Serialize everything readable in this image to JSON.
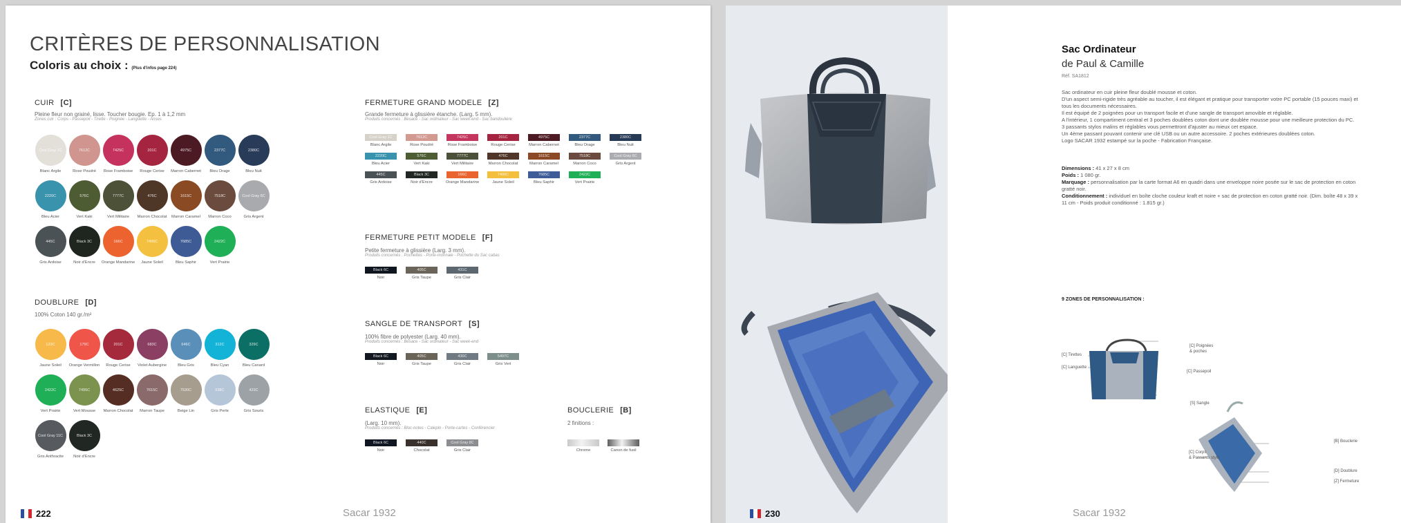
{
  "left_page": {
    "title": "CRITÈRES DE PERSONNALISATION",
    "subtitle": "Coloris au choix :",
    "subtitle_note": "(Plus d'infos page 224)",
    "page_number": "222",
    "brand": "Sacar 1932",
    "cuir": {
      "label": "CUIR",
      "code": "[C]",
      "desc": "Pleine fleur non grainé, lisse. Toucher bougie. Ep. 1 à 1,2 mm",
      "zones": "Zones cuir : Corps - Passepoil - Tirette - Poignée - Languette - Anses",
      "colors": [
        {
          "code": "Cool Gray 1C",
          "name": "Blanc Argile",
          "hex": "#e3e0da"
        },
        {
          "code": "7612C",
          "name": "Rose Poudré",
          "hex": "#cf958e"
        },
        {
          "code": "7425C",
          "name": "Rose Framboise",
          "hex": "#c4325d"
        },
        {
          "code": "201C",
          "name": "Rouge Cerise",
          "hex": "#a52440"
        },
        {
          "code": "4975C",
          "name": "Marron Cabernet",
          "hex": "#4c1a22"
        },
        {
          "code": "2377C",
          "name": "Bleu Orage",
          "hex": "#325a7e"
        },
        {
          "code": "2380C",
          "name": "Bleu Nuit",
          "hex": "#283b58"
        },
        {
          "code": "2220C",
          "name": "Bleu Acier",
          "hex": "#3a93ad"
        },
        {
          "code": "576C",
          "name": "Vert Kaki",
          "hex": "#4d5c33"
        },
        {
          "code": "7777C",
          "name": "Vert Militaire",
          "hex": "#4c5138"
        },
        {
          "code": "476C",
          "name": "Marron Chocolat",
          "hex": "#4f3728"
        },
        {
          "code": "1615C",
          "name": "Marron Caramel",
          "hex": "#8a4a24"
        },
        {
          "code": "7518C",
          "name": "Marron Coco",
          "hex": "#6a4b3d"
        },
        {
          "code": "Cool Gray 6C",
          "name": "Gris Argent",
          "hex": "#a8aaae"
        },
        {
          "code": "445C",
          "name": "Gris Ardoise",
          "hex": "#4b5256"
        },
        {
          "code": "Black 3C",
          "name": "Noir d'Encre",
          "hex": "#1f2620"
        },
        {
          "code": "166C",
          "name": "Orange Mandarine",
          "hex": "#ed632f"
        },
        {
          "code": "7406C",
          "name": "Jaune Soleil",
          "hex": "#f4c03f"
        },
        {
          "code": "7685C",
          "name": "Bleu Saphir",
          "hex": "#3e5b96"
        },
        {
          "code": "2422C",
          "name": "Vert Prairie",
          "hex": "#1faf56"
        }
      ]
    },
    "doublure": {
      "label": "DOUBLURE",
      "code": "[D]",
      "desc": "100% Coton 140 gr./m²",
      "colors": [
        {
          "code": "123C",
          "name": "Jaune Soleil",
          "hex": "#f7b949"
        },
        {
          "code": "179C",
          "name": "Orange Vermillon",
          "hex": "#ef5548"
        },
        {
          "code": "201C",
          "name": "Rouge Cerise",
          "hex": "#a42a3c"
        },
        {
          "code": "683C",
          "name": "Violet Aubergine",
          "hex": "#8a3f63"
        },
        {
          "code": "646C",
          "name": "Bleu Gris",
          "hex": "#5a8fba"
        },
        {
          "code": "312C",
          "name": "Bleu Cyan",
          "hex": "#12b3d6"
        },
        {
          "code": "329C",
          "name": "Bleu Canard",
          "hex": "#0b6f66"
        },
        {
          "code": "2422C",
          "name": "Vert Prairie",
          "hex": "#1faf56"
        },
        {
          "code": "7495C",
          "name": "Vert Mousse",
          "hex": "#7c9350"
        },
        {
          "code": "4625C",
          "name": "Marron Chocolat",
          "hex": "#552d22"
        },
        {
          "code": "7615C",
          "name": "Marron Taupe",
          "hex": "#8a6a6a"
        },
        {
          "code": "7530C",
          "name": "Beige Lin",
          "hex": "#a79d8e"
        },
        {
          "code": "538C",
          "name": "Gris Perle",
          "hex": "#b6c6d9"
        },
        {
          "code": "423C",
          "name": "Gris Souris",
          "hex": "#9da2a7"
        },
        {
          "code": "Cool Gray 11C",
          "name": "Gris Anthracite",
          "hex": "#575b60"
        },
        {
          "code": "Black 3C",
          "name": "Noir d'Encre",
          "hex": "#212722"
        }
      ]
    },
    "grand": {
      "label": "FERMETURE GRAND MODELE",
      "code": "[Z]",
      "desc": "Grande fermeture à glissière étanche. (Larg. 5 mm).",
      "products": "Produits concernés : Besace - Sac ordinateur - Sac week-end - Sac bandoulière",
      "colors": [
        {
          "code": "Cool Gray 1C",
          "name": "Blanc Argile",
          "hex": "#d7d2c9"
        },
        {
          "code": "7612C",
          "name": "Rose Poudré",
          "hex": "#d39a92"
        },
        {
          "code": "7425C",
          "name": "Rose Framboise",
          "hex": "#c4365e"
        },
        {
          "code": "201C",
          "name": "Rouge Cerise",
          "hex": "#a52440"
        },
        {
          "code": "4975C",
          "name": "Marron Cabernet",
          "hex": "#4e1b25"
        },
        {
          "code": "2377C",
          "name": "Bleu Orage",
          "hex": "#325a7e"
        },
        {
          "code": "2380C",
          "name": "Bleu Nuit",
          "hex": "#263a56"
        },
        {
          "code": "2220C",
          "name": "Bleu Acier",
          "hex": "#3993ae"
        },
        {
          "code": "576C",
          "name": "Vert Kaki",
          "hex": "#4f5d34"
        },
        {
          "code": "7777C",
          "name": "Vert Militaire",
          "hex": "#4b503a"
        },
        {
          "code": "476C",
          "name": "Marron Chocolat",
          "hex": "#4f3628"
        },
        {
          "code": "1615C",
          "name": "Marron Caramel",
          "hex": "#8b4a25"
        },
        {
          "code": "7518C",
          "name": "Marron Coco",
          "hex": "#6b4b3f"
        },
        {
          "code": "Cool Gray 6C",
          "name": "Gris Argent",
          "hex": "#aaacaf"
        },
        {
          "code": "445C",
          "name": "Gris Ardoise",
          "hex": "#4b5256"
        },
        {
          "code": "Black 3C",
          "name": "Noir d'Encre",
          "hex": "#212722"
        },
        {
          "code": "166C",
          "name": "Orange Mandarine",
          "hex": "#ea642f"
        },
        {
          "code": "7406C",
          "name": "Jaune Soleil",
          "hex": "#f3bf3c"
        },
        {
          "code": "7685C",
          "name": "Bleu Saphir",
          "hex": "#3d5c98"
        },
        {
          "code": "2422C",
          "name": "Vert Prairie",
          "hex": "#1faf56"
        }
      ]
    },
    "petit": {
      "label": "FERMETURE PETIT MODELE",
      "code": "[F]",
      "desc": "Petite fermeture à glissière (Larg. 3 mm).",
      "products": "Produits concernés : Pochettes - Porte-monnaie - Pochette du Sac cabas",
      "colors": [
        {
          "code": "Black 6C",
          "name": "Noir",
          "hex": "#0f1620"
        },
        {
          "code": "405C",
          "name": "Gris Taupe",
          "hex": "#6b645a"
        },
        {
          "code": "431C",
          "name": "Gris Clair",
          "hex": "#5c6770"
        }
      ]
    },
    "sangle": {
      "label": "SANGLE DE TRANSPORT",
      "code": "[S]",
      "desc": "100% fibre de polyester (Larg. 40 mm).",
      "products": "Produits concernés : Besace - Sac ordinateur - Sac week-end",
      "colors": [
        {
          "code": "Black 6C",
          "name": "Noir",
          "hex": "#121820"
        },
        {
          "code": "405C",
          "name": "Gris Taupe",
          "hex": "#6a6358"
        },
        {
          "code": "430C",
          "name": "Gris Clair",
          "hex": "#6f7a82"
        },
        {
          "code": "5497C",
          "name": "Gris Vert",
          "hex": "#7e8f8b"
        }
      ]
    },
    "elastique": {
      "label": "ELASTIQUE",
      "code": "[E]",
      "desc": "(Larg. 10 mm).",
      "products": "Produits concernés : Bloc-notes - Calepin - Porte-cartes - Conférencier",
      "colors": [
        {
          "code": "Black 6C",
          "name": "Noir",
          "hex": "#101722"
        },
        {
          "code": "440C",
          "name": "Chocolat",
          "hex": "#3a302c"
        },
        {
          "code": "Cool Gray 8C",
          "name": "Gris Clair",
          "hex": "#8b8d90"
        }
      ]
    },
    "bouclerie": {
      "label": "BOUCLERIE",
      "code": "[B]",
      "desc": "2 finitions :",
      "finishes": [
        {
          "name": "Chrome",
          "hex": "#c9c9c9"
        },
        {
          "name": "Canon de fusil",
          "hex": "#5e5e5e"
        }
      ]
    }
  },
  "right_page": {
    "page_number": "230",
    "brand": "Sacar 1932",
    "product_title": "Sac Ordinateur",
    "product_sub": "de Paul & Camille",
    "ref": "Réf. SA1812",
    "paragraphs": [
      "Sac ordinateur en cuir pleine fleur doublé mousse et coton.",
      "D'un aspect semi-rigide très agréable au toucher, il est élégant et pratique pour transporter votre PC portable (15 pouces maxi) et tous les documents nécessaires.",
      "Il est équipé de 2 poignées pour un transport facile et d'une sangle de transport amovible et réglable.",
      "A l'intérieur, 1 compartiment central et 3 poches doublées coton dont une doublée mousse pour une meilleure protection du PC.",
      "3 passants stylos malins et réglables vous permettront d'ajuster au mieux cet espace.",
      "Un 4ème passant pouvant contenir une clé USB ou un autre accessoire. 2 poches extérieures doublées coton.",
      "Logo SACAR 1932 estampé sur la poche - Fabrication Française."
    ],
    "specs": [
      {
        "label": "Dimensions :",
        "value": " 41 x 27 x 8 cm"
      },
      {
        "label": "Poids :",
        "value": " 1 080 gr."
      },
      {
        "label": "Marquage :",
        "value": " personnalisation par la carte format A6 en quadri dans une enveloppe noire posée sur le sac de protection en coton gratté noir."
      },
      {
        "label": "Conditionnement :",
        "value": " individuel en boîte cloche couleur kraft et noire + sac de protection en coton gratté noir. (Dim. boîte 48 x 39 x 11 cm - Poids produit conditionné : 1.815 gr.)"
      }
    ],
    "zones_title": "9 ZONES DE PERSONNALISATION :",
    "zones": {
      "tirettes": "[C] Tirettes",
      "languette": "[C] Languette",
      "poignees_1": "[C] Poignées",
      "poignees_2": "& poches",
      "passepoil": "[C] Passepoil",
      "sangle": "[S] Sangle",
      "bouclerie": "[B] Bouclerie",
      "corps_1": "[C] Corps",
      "corps_2": "& Passants stylo",
      "doublure": "[D] Doublure",
      "fermeture": "[Z] Fermeture"
    }
  },
  "colors": {
    "flag_blue": "#2a4fa0",
    "flag_white": "#ffffff",
    "flag_red": "#d4262b",
    "panel": "#e7eaef"
  }
}
